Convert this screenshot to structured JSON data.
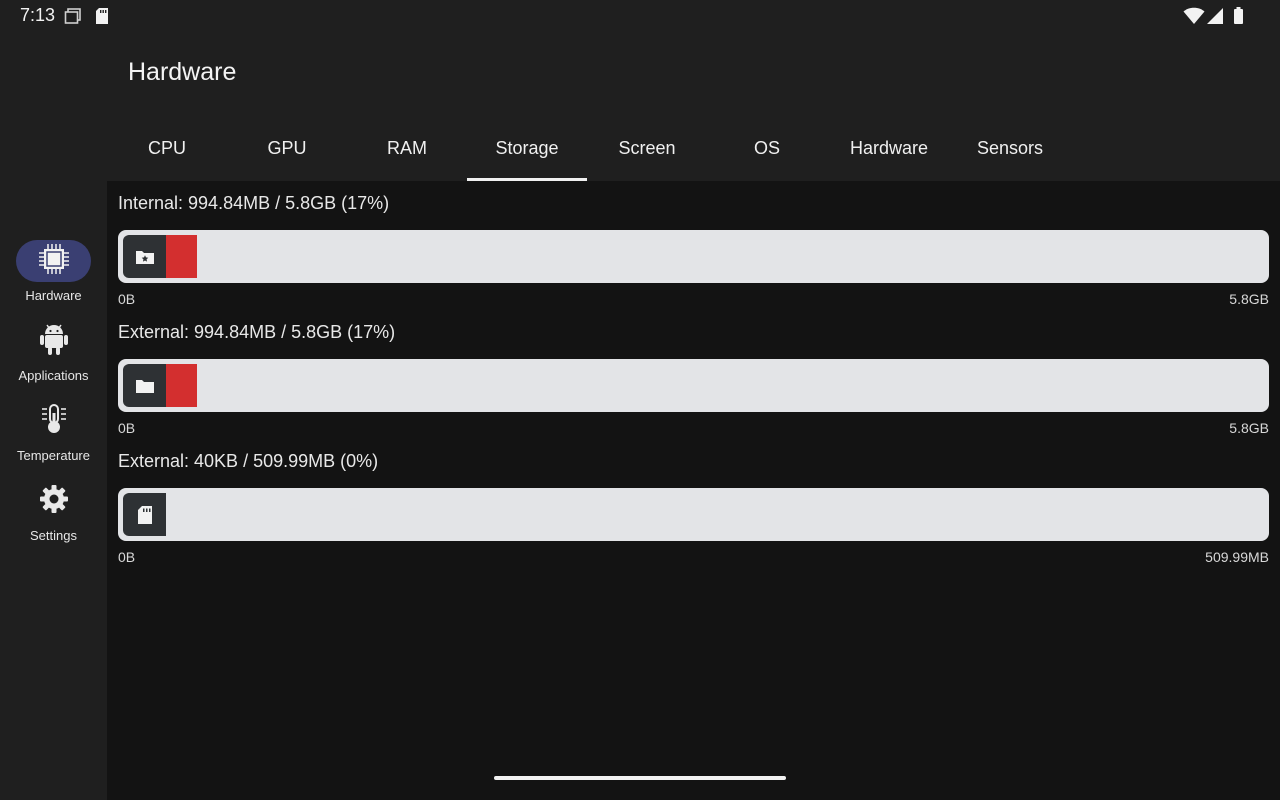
{
  "status_bar": {
    "time": "7:13",
    "icons": [
      "screenshot-icon",
      "sd-card-icon",
      "wifi-icon",
      "cellular-icon",
      "battery-icon"
    ]
  },
  "app_bar": {
    "title": "Hardware"
  },
  "tabs": [
    {
      "label": "CPU",
      "active": false
    },
    {
      "label": "GPU",
      "active": false
    },
    {
      "label": "RAM",
      "active": false
    },
    {
      "label": "Storage",
      "active": true
    },
    {
      "label": "Screen",
      "active": false
    },
    {
      "label": "OS",
      "active": false
    },
    {
      "label": "Hardware",
      "active": false
    },
    {
      "label": "Sensors",
      "active": false
    }
  ],
  "sidebar": {
    "items": [
      {
        "label": "Hardware",
        "icon": "chip-icon",
        "active": true
      },
      {
        "label": "Applications",
        "icon": "android-icon",
        "active": false
      },
      {
        "label": "Temperature",
        "icon": "thermometer-icon",
        "active": false
      },
      {
        "label": "Settings",
        "icon": "gear-icon",
        "active": false
      }
    ]
  },
  "storage": [
    {
      "title": "Internal: 994.84MB / 5.8GB (17%)",
      "icon": "folder-star-icon",
      "fill_percent": 17,
      "min_label": "0B",
      "max_label": "5.8GB"
    },
    {
      "title": "External: 994.84MB / 5.8GB (17%)",
      "icon": "folder-icon",
      "fill_percent": 17,
      "min_label": "0B",
      "max_label": "5.8GB"
    },
    {
      "title": "External: 40KB / 509.99MB (0%)",
      "icon": "sd-card-icon",
      "fill_percent": 0,
      "min_label": "0B",
      "max_label": "509.99MB"
    }
  ],
  "colors": {
    "accent_fill": "#d32f2f",
    "active_nav": "#3a3f72",
    "bar_track": "#e3e4e7"
  }
}
